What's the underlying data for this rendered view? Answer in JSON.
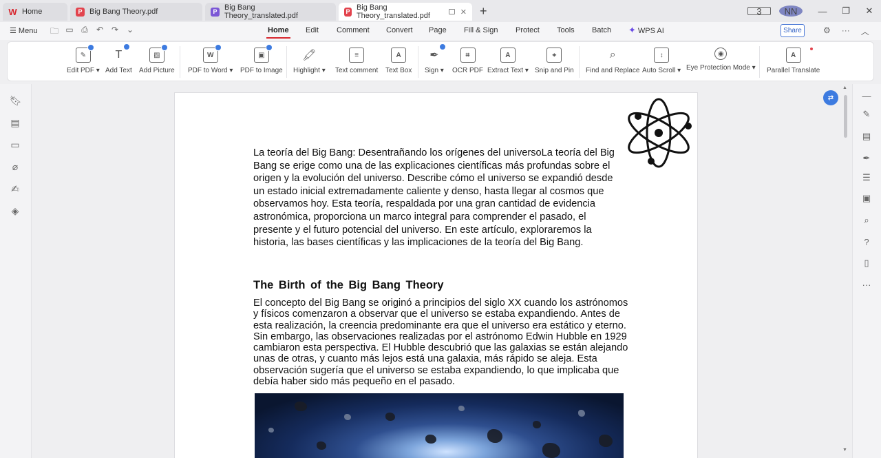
{
  "tabs": [
    {
      "label": "Home",
      "icon": "wps-logo-icon"
    },
    {
      "label": "Big Bang Theory.pdf",
      "icon": "pdf-icon"
    },
    {
      "label": "Big Bang Theory_translated.pdf",
      "icon": "translate-icon"
    },
    {
      "label": "Big Bang Theory_translated.pdf",
      "icon": "pdf-icon",
      "active": true
    }
  ],
  "window": {
    "badge": "3",
    "avatar": "NN"
  },
  "menu": {
    "menu_label": "Menu",
    "tabs": [
      "Home",
      "Edit",
      "Comment",
      "Convert",
      "Page",
      "Fill & Sign",
      "Protect",
      "Tools",
      "Batch",
      "WPS AI"
    ],
    "active_tab": "Home",
    "share_label": "Share"
  },
  "ribbon": {
    "items": [
      {
        "label": "Edit PDF ▾",
        "icon": "edit-pdf-icon"
      },
      {
        "label": "Add Text",
        "icon": "add-text-icon"
      },
      {
        "label": "Add Picture",
        "icon": "add-picture-icon"
      },
      {
        "label": "PDF to Word ▾",
        "icon": "pdf-to-word-icon"
      },
      {
        "label": "PDF to Image",
        "icon": "pdf-to-image-icon"
      },
      {
        "label": "Highlight ▾",
        "icon": "highlight-icon"
      },
      {
        "label": "Text comment",
        "icon": "text-comment-icon"
      },
      {
        "label": "Text Box",
        "icon": "text-box-icon"
      },
      {
        "label": "Sign ▾",
        "icon": "sign-icon"
      },
      {
        "label": "OCR PDF",
        "icon": "ocr-icon"
      },
      {
        "label": "Extract Text ▾",
        "icon": "extract-text-icon"
      },
      {
        "label": "Snip and Pin",
        "icon": "snip-pin-icon"
      },
      {
        "label": "Find and Replace",
        "icon": "search-icon"
      },
      {
        "label": "Auto Scroll ▾",
        "icon": "auto-scroll-icon"
      },
      {
        "label": "Eye Protection Mode ▾",
        "icon": "eye-icon"
      },
      {
        "label": "Parallel Translate",
        "icon": "parallel-translate-icon"
      }
    ]
  },
  "document": {
    "intro": "La teoría del Big Bang: Desentrañando los orígenes del universoLa teoría del Big Bang se erige como una de las explicaciones científicas más profundas sobre el origen y la evolución del universo. Describe cómo el universo se expandió desde un estado inicial extremadamente caliente y denso, hasta llegar al cosmos que observamos hoy. Esta teoría, respaldada por una gran cantidad de evidencia astronómica, proporciona un marco integral para comprender el pasado, el presente y el futuro potencial del universo. En este artículo, exploraremos la historia, las bases científicas y las implicaciones de la teoría del Big Bang.",
    "heading": "The Birth of the Big Bang Theory",
    "body": "El concepto del Big Bang se originó a principios del siglo XX cuando los astrónomos y físicos comenzaron a observar que el universo se estaba expandiendo. Antes de esta realización, la creencia predominante era que el universo era estático y eterno. Sin embargo, las observaciones realizadas por el astrónomo Edwin Hubble en 1929 cambiaron esta perspectiva. El Hubble descubrió que las galaxias se están alejando unas de otras, y cuanto más lejos está una galaxia, más rápido se aleja. Esta observación sugería que el universo se estaba expandiendo, lo que implicaba que debía haber sido más pequeño en el pasado."
  }
}
